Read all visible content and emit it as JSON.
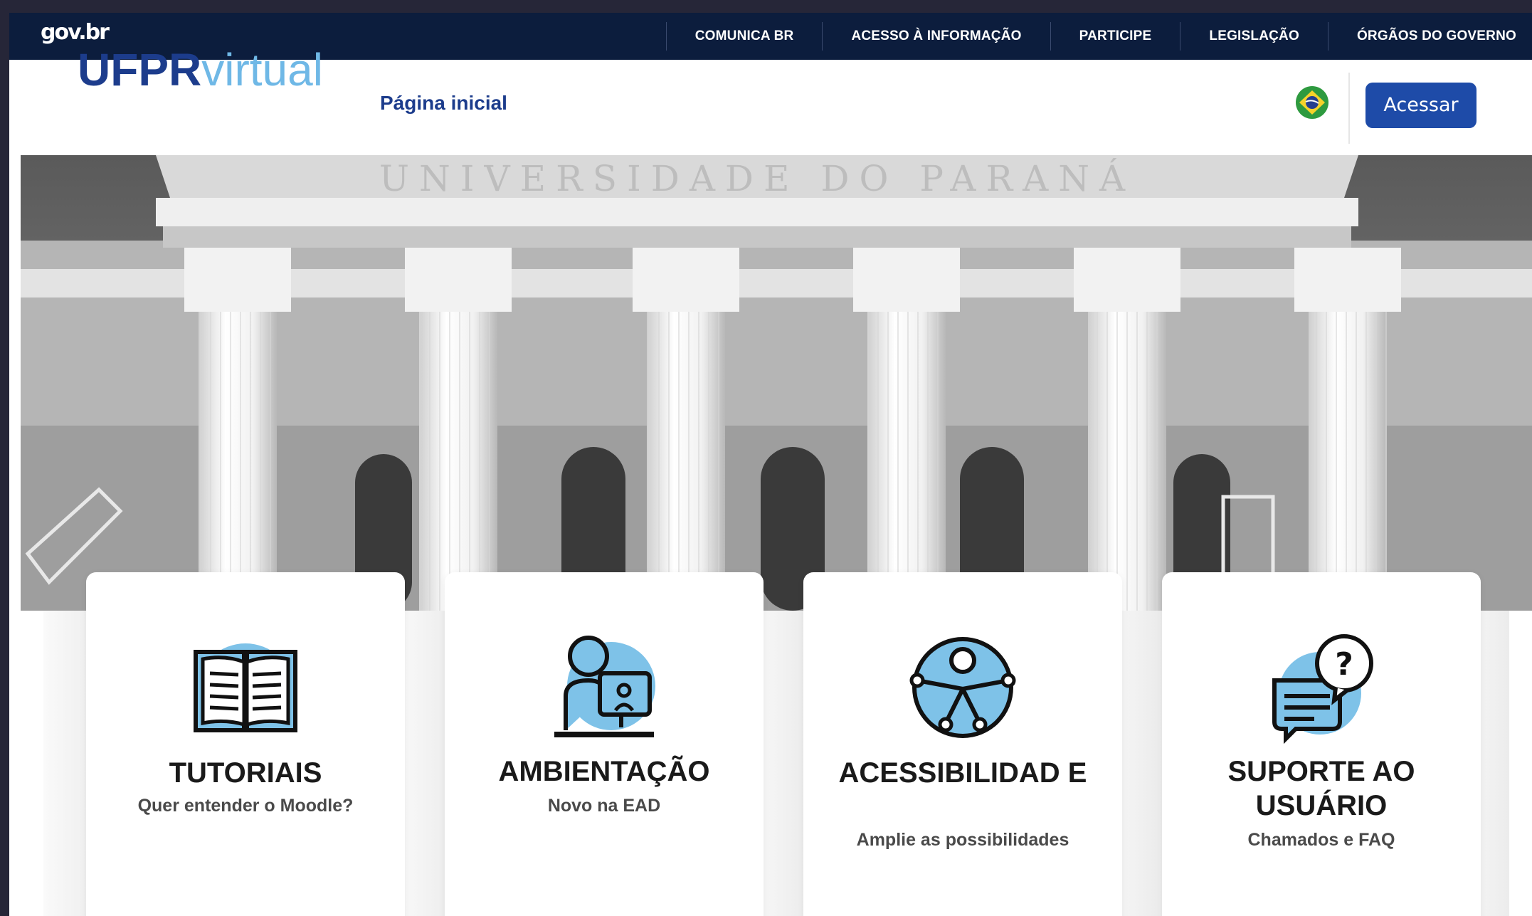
{
  "gov": {
    "logo": "gov.br",
    "links": [
      "COMUNICA BR",
      "ACESSO À INFORMAÇÃO",
      "PARTICIPE",
      "LEGISLAÇÃO",
      "ÓRGÃOS DO GOVERNO"
    ]
  },
  "header": {
    "brand_bold": "UFPR",
    "brand_light": "virtual",
    "home_link": "Página inicial",
    "language_icon": "brazil-flag-icon",
    "login_button": "Acessar"
  },
  "hero": {
    "inscription": "UNIVERSIDADE DO PARANÁ"
  },
  "cards": [
    {
      "title": "TUTORIAIS",
      "subtitle": "Quer entender o Moodle?",
      "icon": "book-icon"
    },
    {
      "title": "AMBIENTAÇÃO",
      "subtitle": "Novo na EAD",
      "icon": "student-computer-icon"
    },
    {
      "title": "ACESSIBILIDAD E",
      "subtitle": "Amplie as possibilidades",
      "icon": "accessibility-icon"
    },
    {
      "title": "SUPORTE AO USUÁRIO",
      "subtitle": "Chamados e FAQ",
      "icon": "support-chat-icon"
    }
  ],
  "colors": {
    "gov_bar": "#0c1d3d",
    "brand_dark": "#1c3c8c",
    "brand_light": "#6fb8e6",
    "button": "#1e4ba8",
    "icon_accent": "#7ec2e8"
  }
}
